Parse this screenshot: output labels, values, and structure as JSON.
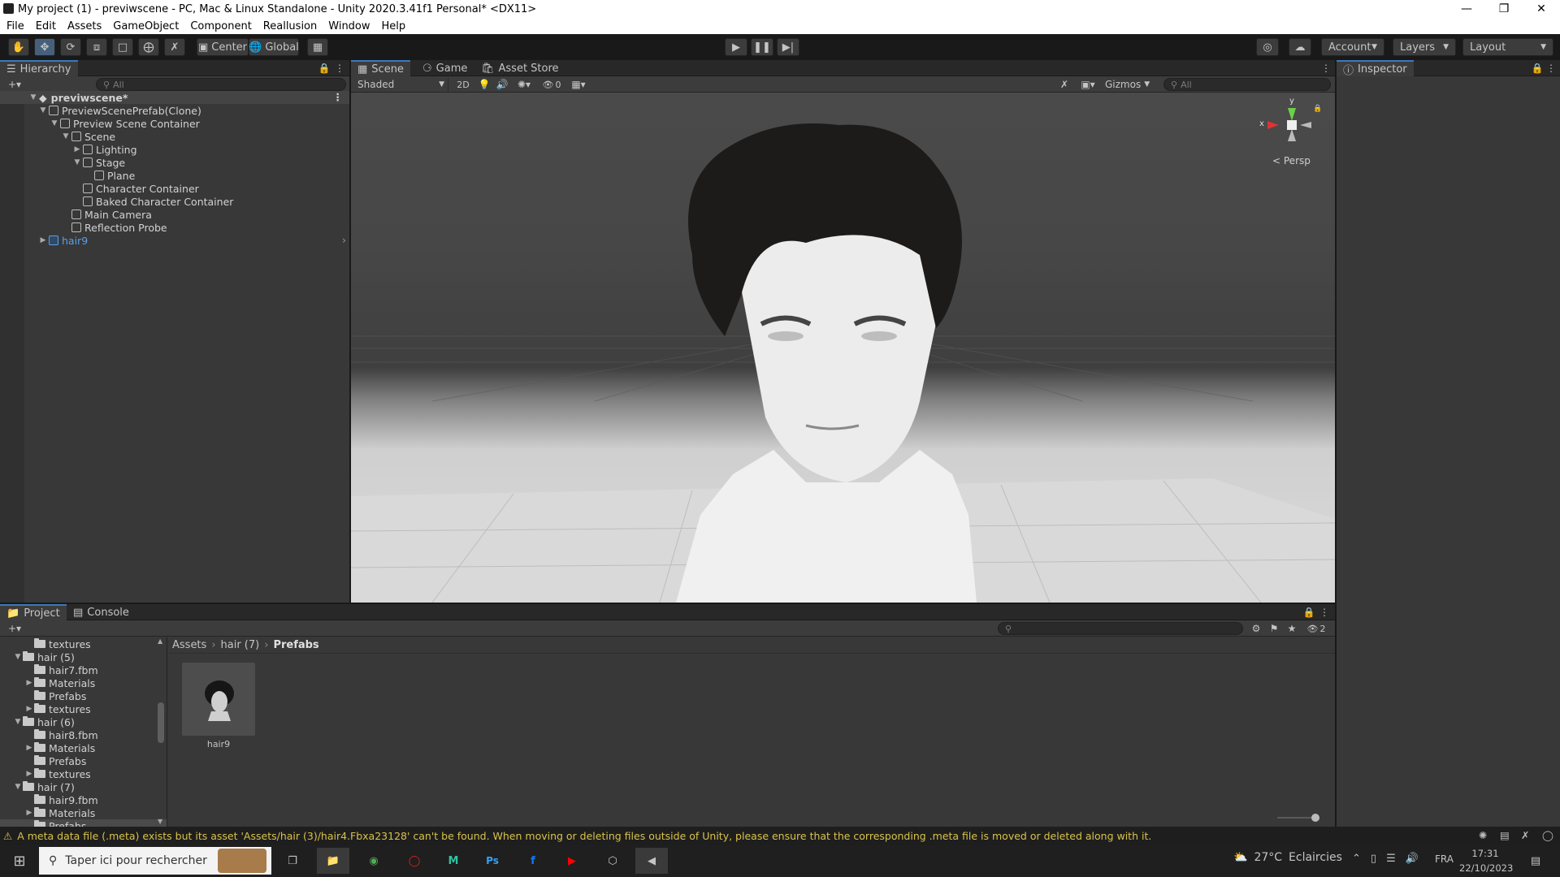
{
  "window": {
    "title": "My project (1) - previwscene - PC, Mac & Linux Standalone - Unity 2020.3.41f1 Personal* <DX11>"
  },
  "menu": [
    "File",
    "Edit",
    "Assets",
    "GameObject",
    "Component",
    "Reallusion",
    "Window",
    "Help"
  ],
  "toolbar": {
    "pivot": "Center",
    "space": "Global",
    "account": "Account",
    "layers": "Layers",
    "layout": "Layout"
  },
  "hierarchy": {
    "tab": "Hierarchy",
    "search_placeholder": "All",
    "scene": "previwscene*",
    "items": [
      {
        "label": "PreviewScenePrefab(Clone)"
      },
      {
        "label": "Preview Scene Container"
      },
      {
        "label": "Scene"
      },
      {
        "label": "Lighting"
      },
      {
        "label": "Stage"
      },
      {
        "label": "Plane"
      },
      {
        "label": "Character Container"
      },
      {
        "label": "Baked Character Container"
      },
      {
        "label": "Main Camera"
      },
      {
        "label": "Reflection Probe"
      },
      {
        "label": "hair9"
      }
    ]
  },
  "scene_tabs": {
    "scene": "Scene",
    "game": "Game",
    "asset_store": "Asset Store"
  },
  "scene_toolbar": {
    "shading": "Shaded",
    "mode_2d": "2D",
    "hidden_count": "0",
    "gizmos": "Gizmos",
    "search_placeholder": "All"
  },
  "gizmo": {
    "y": "y",
    "x": "x",
    "persp": "Persp"
  },
  "inspector": {
    "tab": "Inspector"
  },
  "project": {
    "tab": "Project",
    "console_tab": "Console",
    "hidden_count": "2",
    "breadcrumb": [
      "Assets",
      "hair (7)",
      "Prefabs"
    ],
    "tree": [
      {
        "label": "textures",
        "depth": 2,
        "arrow": ""
      },
      {
        "label": "hair (5)",
        "depth": 1,
        "arrow": "▼"
      },
      {
        "label": "hair7.fbm",
        "depth": 2,
        "arrow": ""
      },
      {
        "label": "Materials",
        "depth": 2,
        "arrow": "▶"
      },
      {
        "label": "Prefabs",
        "depth": 2,
        "arrow": ""
      },
      {
        "label": "textures",
        "depth": 2,
        "arrow": "▶"
      },
      {
        "label": "hair (6)",
        "depth": 1,
        "arrow": "▼"
      },
      {
        "label": "hair8.fbm",
        "depth": 2,
        "arrow": ""
      },
      {
        "label": "Materials",
        "depth": 2,
        "arrow": "▶"
      },
      {
        "label": "Prefabs",
        "depth": 2,
        "arrow": ""
      },
      {
        "label": "textures",
        "depth": 2,
        "arrow": "▶"
      },
      {
        "label": "hair (7)",
        "depth": 1,
        "arrow": "▼"
      },
      {
        "label": "hair9.fbm",
        "depth": 2,
        "arrow": ""
      },
      {
        "label": "Materials",
        "depth": 2,
        "arrow": "▶"
      },
      {
        "label": "Prefabs",
        "depth": 2,
        "arrow": ""
      }
    ],
    "asset": {
      "label": "hair9"
    }
  },
  "status": {
    "message": "A meta data file (.meta) exists but its asset 'Assets/hair (3)/hair4.Fbxa23128' can't be found. When moving or deleting files outside of Unity, please ensure that the corresponding .meta file is moved or deleted along with it."
  },
  "taskbar": {
    "search_placeholder": "Taper ici pour rechercher",
    "weather_temp": "27°C",
    "weather_text": "Eclaircies",
    "lang": "FRA",
    "time": "17:31",
    "date": "22/10/2023"
  },
  "colors": {
    "accent": "#3a79bb",
    "warning": "#d8c24a",
    "prefab": "#5b9ee6",
    "editor_bg": "#383838"
  }
}
